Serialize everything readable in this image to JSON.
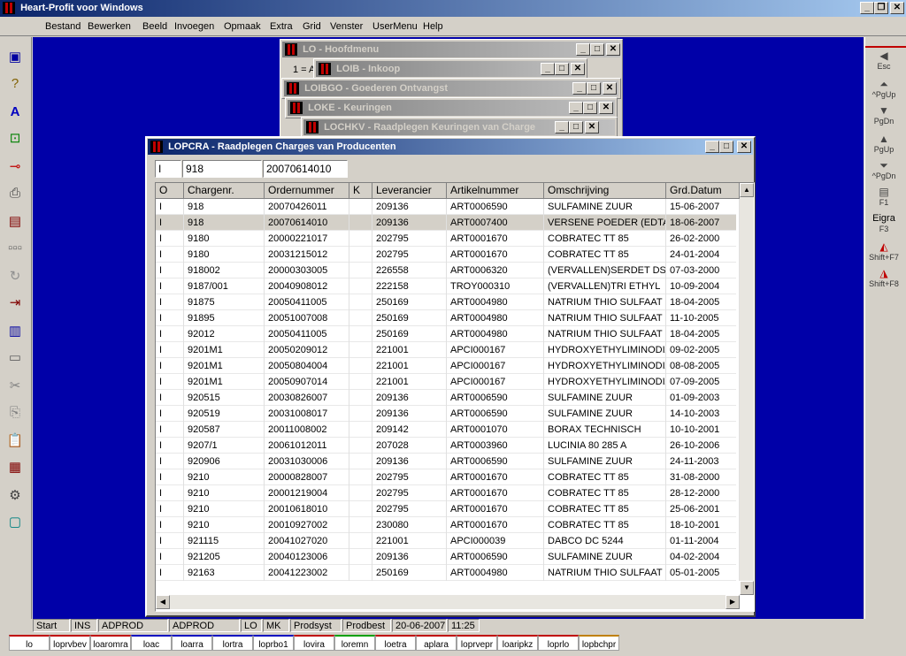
{
  "app": {
    "title": "Heart-Profit voor Windows"
  },
  "menu": [
    "Bestand",
    "Bewerken",
    "Beeld",
    "Invoegen",
    "Opmaak",
    "Extra",
    "Grid",
    "Venster",
    "UserMenu",
    "Help"
  ],
  "windows": {
    "hoofdmenu": {
      "title": "LO - Hoofdmenu",
      "content": "1 = A"
    },
    "inkoop": {
      "title": "LOIB - Inkoop"
    },
    "ontvangst": {
      "title": "LOIBGO - Goederen Ontvangst"
    },
    "keuringen": {
      "title": "LOKE - Keuringen"
    },
    "raadplegen_keuringen": {
      "title": "LOCHKV - Raadplegen Keuringen van Charge"
    }
  },
  "main": {
    "title": "LOPCRA - Raadplegen Charges van Producenten",
    "filters": {
      "f1": "I",
      "f2": "918",
      "f3": "20070614010"
    },
    "columns": [
      "O",
      "Chargenr.",
      "Ordernummer",
      "K",
      "Leverancier",
      "Artikelnummer",
      "Omschrijving",
      "Grd.Datum"
    ],
    "rows": [
      [
        "I",
        "918",
        "20070426011",
        "",
        "209136",
        "ART0006590",
        "SULFAMINE ZUUR",
        "15-06-2007"
      ],
      [
        "I",
        "918",
        "20070614010",
        "",
        "209136",
        "ART0007400",
        "VERSENE POEDER (EDTA",
        "18-06-2007"
      ],
      [
        "I",
        "9180",
        "20000221017",
        "",
        "202795",
        "ART0001670",
        "COBRATEC TT 85",
        "26-02-2000"
      ],
      [
        "I",
        "9180",
        "20031215012",
        "",
        "202795",
        "ART0001670",
        "COBRATEC TT 85",
        "24-01-2004"
      ],
      [
        "I",
        "918002",
        "20000303005",
        "",
        "226558",
        "ART0006320",
        "(VERVALLEN)SERDET DS",
        "07-03-2000"
      ],
      [
        "I",
        "9187/001",
        "20040908012",
        "",
        "222158",
        "TROY000310",
        "(VERVALLEN)TRI ETHYL",
        "10-09-2004"
      ],
      [
        "I",
        "91875",
        "20050411005",
        "",
        "250169",
        "ART0004980",
        "NATRIUM THIO SULFAAT",
        "18-04-2005"
      ],
      [
        "I",
        "91895",
        "20051007008",
        "",
        "250169",
        "ART0004980",
        "NATRIUM THIO SULFAAT",
        "11-10-2005"
      ],
      [
        "I",
        "92012",
        "20050411005",
        "",
        "250169",
        "ART0004980",
        "NATRIUM THIO SULFAAT",
        "18-04-2005"
      ],
      [
        "I",
        "9201M1",
        "20050209012",
        "",
        "221001",
        "APCI000167",
        "HYDROXYETHYLIMINODIA",
        "09-02-2005"
      ],
      [
        "I",
        "9201M1",
        "20050804004",
        "",
        "221001",
        "APCI000167",
        "HYDROXYETHYLIMINODIA",
        "08-08-2005"
      ],
      [
        "I",
        "9201M1",
        "20050907014",
        "",
        "221001",
        "APCI000167",
        "HYDROXYETHYLIMINODIA",
        "07-09-2005"
      ],
      [
        "I",
        "920515",
        "20030826007",
        "",
        "209136",
        "ART0006590",
        "SULFAMINE ZUUR",
        "01-09-2003"
      ],
      [
        "I",
        "920519",
        "20031008017",
        "",
        "209136",
        "ART0006590",
        "SULFAMINE ZUUR",
        "14-10-2003"
      ],
      [
        "I",
        "920587",
        "20011008002",
        "",
        "209142",
        "ART0001070",
        "BORAX TECHNISCH",
        "10-10-2001"
      ],
      [
        "I",
        "9207/1",
        "20061012011",
        "",
        "207028",
        "ART0003960",
        "LUCINIA 80 285 A",
        "26-10-2006"
      ],
      [
        "I",
        "920906",
        "20031030006",
        "",
        "209136",
        "ART0006590",
        "SULFAMINE ZUUR",
        "24-11-2003"
      ],
      [
        "I",
        "9210",
        "20000828007",
        "",
        "202795",
        "ART0001670",
        "COBRATEC TT 85",
        "31-08-2000"
      ],
      [
        "I",
        "9210",
        "20001219004",
        "",
        "202795",
        "ART0001670",
        "COBRATEC TT 85",
        "28-12-2000"
      ],
      [
        "I",
        "9210",
        "20010618010",
        "",
        "202795",
        "ART0001670",
        "COBRATEC TT 85",
        "25-06-2001"
      ],
      [
        "I",
        "9210",
        "20010927002",
        "",
        "230080",
        "ART0001670",
        "COBRATEC TT 85",
        "18-10-2001"
      ],
      [
        "I",
        "921115",
        "20041027020",
        "",
        "221001",
        "APCI000039",
        "DABCO DC 5244",
        "01-11-2004"
      ],
      [
        "I",
        "921205",
        "20040123006",
        "",
        "209136",
        "ART0006590",
        "SULFAMINE ZUUR",
        "04-02-2004"
      ],
      [
        "I",
        "92163",
        "20041223002",
        "",
        "250169",
        "ART0004980",
        "NATRIUM THIO SULFAAT",
        "05-01-2005"
      ]
    ]
  },
  "right_toolbar": [
    {
      "label": "Esc",
      "icon": "left-arrow-icon"
    },
    {
      "label": "^PgUp",
      "icon": "double-up-icon"
    },
    {
      "label": "PgDn",
      "icon": "down-icon"
    },
    {
      "label": "PgUp",
      "icon": "up-icon"
    },
    {
      "label": "^PgDn",
      "icon": "double-down-icon"
    },
    {
      "label": "F1",
      "icon": "list-icon"
    },
    {
      "label": "F3",
      "icon": "text-icon",
      "text": "Eigra"
    },
    {
      "label": "Shift+F7",
      "icon": "chart-icon"
    },
    {
      "label": "Shift+F8",
      "icon": "chart-icon"
    }
  ],
  "status": [
    "Start",
    "INS",
    "ADPROD",
    "ADPROD",
    "LO",
    "MK",
    "Prodsyst",
    "Prodbest",
    "20-06-2007",
    "11:25"
  ],
  "taskbar": [
    "lo",
    "loprvbev",
    "loaromra",
    "loac",
    "loarra",
    "lortra",
    "loprbo1",
    "lovira",
    "loremn",
    "loetra",
    "aplara",
    "loprvepr",
    "loaripkz",
    "loprlo",
    "lopbchpr"
  ],
  "colors": {
    "desktop": "#0000a8",
    "titlebar": "#0a246a",
    "selected_row": "#d4d0c8"
  }
}
